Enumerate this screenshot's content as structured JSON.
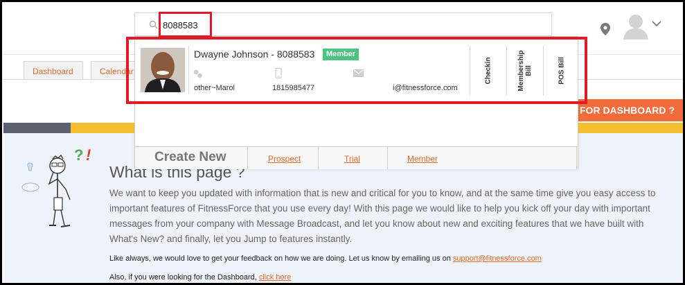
{
  "search": {
    "value": "8088583"
  },
  "tabs": [
    {
      "label": "Dashboard"
    },
    {
      "label": "Calendar"
    }
  ],
  "result": {
    "name": "Dwayne Johnson - 8088583",
    "badge": "Member",
    "location": "other~Marol",
    "mobile": "1815985477",
    "email": "i@fitnessforce.com",
    "actions": [
      "Checkin",
      "Membership Bill",
      "POS Bill"
    ]
  },
  "create": {
    "label": "Create New",
    "links": [
      "Prospect",
      "Trial",
      "Member"
    ]
  },
  "banner": {
    "text": "FOR DASHBOARD ?"
  },
  "page": {
    "title": "What is this page ?",
    "intro": "We want to keep you updated with information that is new and critical for you to know, and at the same time give you easy access to important features of FitnessForce that you use every day! With this page we would like to help you kick off your day with important messages from your company with Message Broadcast, and let you know about new and exciting features that we have built with What's New? and finally, let you Jump to features instantly.",
    "feedback_text": "Like always, we would love to get your feedback on how we are doing. Let us know by emailing us on ",
    "feedback_email": "support@fitnessforce.com",
    "dashboard_text": "Also, if you were looking for the Dashboard, ",
    "dashboard_link": "click here"
  },
  "illustration": {
    "marks": [
      "?",
      "!"
    ]
  },
  "colors": {
    "accent": "#e06a2a",
    "badge": "#4cc47f",
    "annotation": "#e0192b",
    "banner": "#f26b3a"
  },
  "icons": [
    "search-icon",
    "location-pin-icon",
    "user-avatar-icon",
    "chevron-down-icon",
    "phone-icon",
    "mobile-icon",
    "mail-icon"
  ]
}
